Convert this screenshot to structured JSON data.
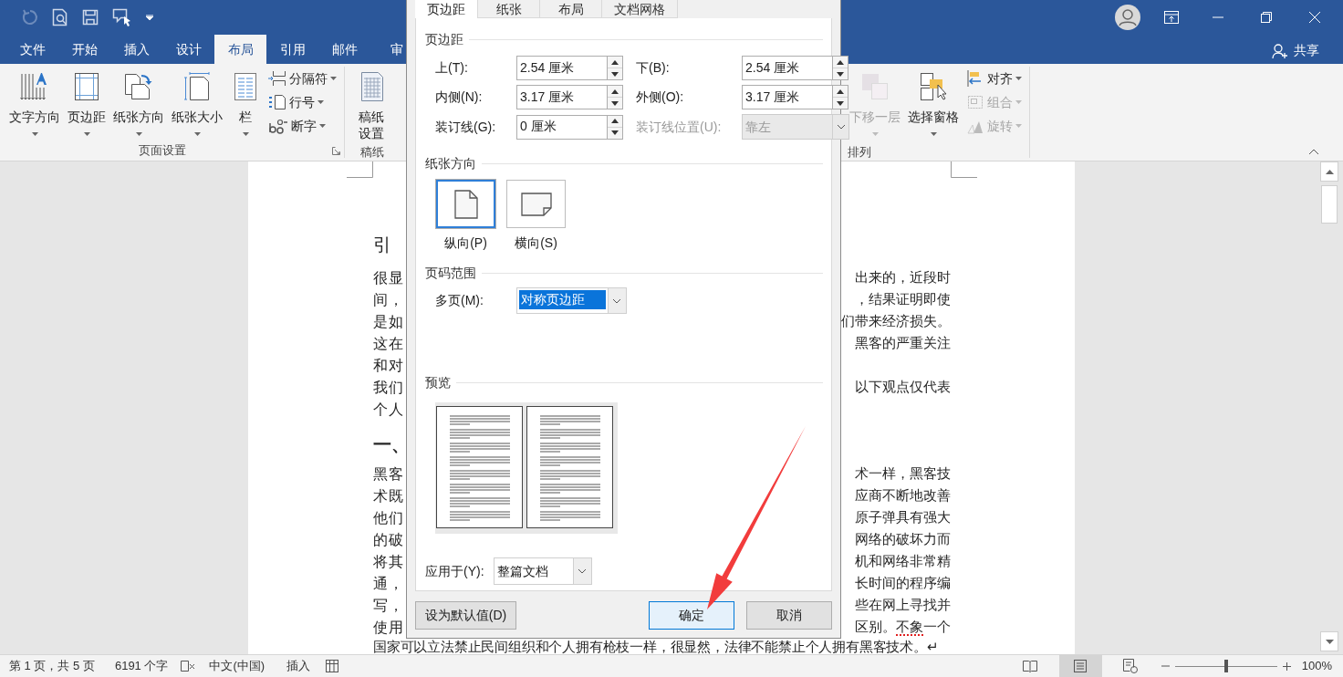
{
  "ribbon_tabs": [
    {
      "label": "文件",
      "selected": false
    },
    {
      "label": "开始",
      "selected": false
    },
    {
      "label": "插入",
      "selected": false
    },
    {
      "label": "设计",
      "selected": false
    },
    {
      "label": "布局",
      "selected": true
    },
    {
      "label": "引用",
      "selected": false
    },
    {
      "label": "邮件",
      "selected": false
    },
    {
      "label": "审",
      "selected": false
    }
  ],
  "share": "共享",
  "ribbon": {
    "page_setup": {
      "large_buttons": [
        "文字方向",
        "页边距",
        "纸张方向",
        "纸张大小",
        "栏"
      ],
      "small_buttons": [
        "分隔符",
        "行号",
        "断字"
      ],
      "label": "页面设置"
    },
    "manuscript": {
      "button": "稿纸设置",
      "label": "稿纸"
    },
    "arrange": {
      "large_buttons": [
        {
          "label": "下移一层",
          "disabled": true
        },
        {
          "label": "选择窗格",
          "disabled": false
        }
      ],
      "small_buttons": [
        {
          "label": "对齐",
          "disabled": false
        },
        {
          "label": "组合",
          "disabled": true
        },
        {
          "label": "旋转",
          "disabled": true
        }
      ],
      "label": "排列"
    }
  },
  "document": {
    "heading_1": "引",
    "paragraph_1": [
      {
        "left": "很显",
        "right": "出来的，近段时"
      },
      {
        "left": "间，",
        "right": "，结果证明即使"
      },
      {
        "left": "是如",
        "right": "们带来经济损失。"
      },
      {
        "left": "这在",
        "right": "黑客的严重关注"
      },
      {
        "left": "和对"
      },
      {
        "left": "我们",
        "right": "以下观点仅代表"
      },
      {
        "left": "个人"
      }
    ],
    "heading_2": "一、",
    "paragraph_2": [
      {
        "left": "黑客",
        "right": "术一样，黑客技"
      },
      {
        "left": "术既",
        "right": "应商不断地改善"
      },
      {
        "left": "他们",
        "right": "原子弹具有强大"
      },
      {
        "left": "的破",
        "right": "网络的破坏力而"
      },
      {
        "left": "将其",
        "right": "机和网络非常精"
      },
      {
        "left": "通，",
        "right": "长时间的程序编"
      },
      {
        "left": "写，",
        "right": "些在网上寻找并"
      },
      {
        "left": "使用",
        "right": [
          {
            "text": "区别。",
            "flagged": false
          },
          {
            "text": "不象",
            "flagged": true
          },
          {
            "text": "一个",
            "flagged": false
          }
        ]
      }
    ],
    "last_line": "国家可以立法禁止民间组织和个人拥有枪枝一样，很显然，法律不能禁止个人拥有黑客技术。↵"
  },
  "dialog": {
    "tabs": [
      {
        "label": "页边距",
        "selected": true
      },
      {
        "label": "纸张",
        "selected": false
      },
      {
        "label": "布局",
        "selected": false
      },
      {
        "label": "文档网格",
        "selected": false
      }
    ],
    "margins_section": "页边距",
    "margin_fields": [
      {
        "label": "上(T):",
        "value": "2.54 厘米"
      },
      {
        "label": "下(B):",
        "value": "2.54 厘米"
      },
      {
        "label": "内侧(N):",
        "value": "3.17 厘米"
      },
      {
        "label": "外侧(O):",
        "value": "3.17 厘米"
      },
      {
        "label": "装订线(G):",
        "value": "0 厘米"
      }
    ],
    "gutter_position": {
      "label": "装订线位置(U):",
      "value": "靠左",
      "disabled": true
    },
    "orientation_section": "纸张方向",
    "orientations": [
      {
        "label": "纵向(P)",
        "selected": true
      },
      {
        "label": "横向(S)",
        "selected": false
      }
    ],
    "pages_section": "页码范围",
    "multiple_pages": {
      "label": "多页(M):",
      "value": "对称页边距"
    },
    "preview_section": "预览",
    "apply_to": {
      "label": "应用于(Y):",
      "value": "整篇文档"
    },
    "buttons": [
      {
        "label": "设为默认值(D)",
        "default": false
      },
      {
        "label": "确定",
        "default": true
      },
      {
        "label": "取消",
        "default": false
      }
    ]
  },
  "status_bar": {
    "page": "第 1 页，共 5 页",
    "words": "6191 个字",
    "language": "中文(中国)",
    "mode": "插入",
    "views": [
      {
        "kind": "read",
        "selected": false
      },
      {
        "kind": "print",
        "selected": true
      },
      {
        "kind": "web",
        "selected": false
      }
    ],
    "zoom": {
      "level": 0.5,
      "reading": "100%"
    }
  }
}
